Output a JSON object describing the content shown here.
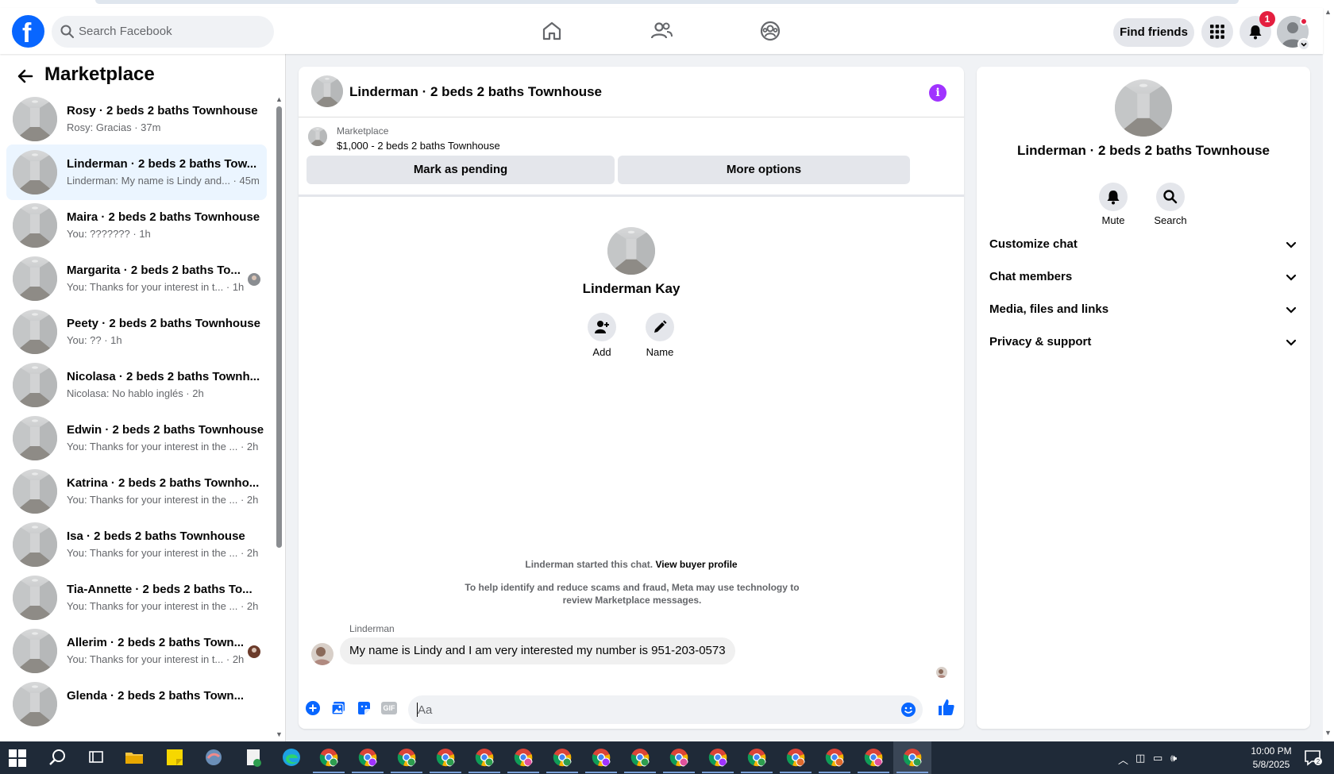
{
  "header": {
    "logo_letter": "f",
    "search_placeholder": "Search Facebook",
    "find_friends_label": "Find friends",
    "notification_count": "1"
  },
  "sidebar": {
    "title": "Marketplace",
    "conversations": [
      {
        "name": "Rosy · 2 beds 2 baths Townhouse",
        "preview": "Rosy: Gracias · 37m",
        "active": false
      },
      {
        "name": "Linderman · 2 beds 2 baths Tow...",
        "preview": "Linderman: My name is Lindy and... · 45m",
        "active": true
      },
      {
        "name": "Maira · 2 beds 2 baths Townhouse",
        "preview": "You: ??????? · 1h",
        "active": false
      },
      {
        "name": "Margarita · 2 beds 2 baths To...",
        "preview": "You: Thanks for your interest in t... · 1h",
        "active": false
      },
      {
        "name": "Peety · 2 beds 2 baths Townhouse",
        "preview": "You: ?? · 1h",
        "active": false
      },
      {
        "name": "Nicolasa · 2 beds 2 baths Townh...",
        "preview": "Nicolasa: No hablo inglés · 2h",
        "active": false
      },
      {
        "name": "Edwin · 2 beds 2 baths Townhouse",
        "preview": "You: Thanks for your interest in the ... · 2h",
        "active": false
      },
      {
        "name": "Katrina · 2 beds 2 baths Townho...",
        "preview": "You: Thanks for your interest in the ... · 2h",
        "active": false
      },
      {
        "name": "Isa · 2 beds 2 baths Townhouse",
        "preview": "You: Thanks for your interest in the ... · 2h",
        "active": false
      },
      {
        "name": "Tia-Annette · 2 beds 2 baths To...",
        "preview": "You: Thanks for your interest in the ... · 2h",
        "active": false
      },
      {
        "name": "Allerim · 2 beds 2 baths Town...",
        "preview": "You: Thanks for your interest in t... · 2h",
        "active": false
      },
      {
        "name": "Glenda · 2 beds 2 baths Town...",
        "preview": "",
        "active": false
      }
    ]
  },
  "chat": {
    "title": "Linderman · 2 beds 2 baths Townhouse",
    "marketplace_label": "Marketplace",
    "listing": "$1,000 - 2 beds 2 baths Townhouse",
    "mark_pending_label": "Mark as pending",
    "more_options_label": "More options",
    "profile_name": "Linderman Kay",
    "add_label": "Add",
    "name_label": "Name",
    "started_text": "Linderman started this chat.",
    "view_buyer_label": "View buyer profile",
    "safety_text": "To help identify and reduce scams and fraud, Meta may use technology to review Marketplace messages.",
    "sender": "Linderman",
    "message": "My name is Lindy and I am very interested my number is 951-203-0573",
    "composer_placeholder": "Aa",
    "gif_label": "GIF"
  },
  "right_panel": {
    "name": "Linderman · 2 beds 2 baths Townhouse",
    "mute_label": "Mute",
    "search_label": "Search",
    "sections": [
      "Customize chat",
      "Chat members",
      "Media, files and links",
      "Privacy & support"
    ]
  },
  "taskbar": {
    "time": "10:00 PM",
    "date": "5/8/2025"
  },
  "colors": {
    "brand": "#0866ff",
    "active_conversation": "#ebf5ff",
    "info_purple": "#a033ff",
    "badge_red": "#e41e3f",
    "taskbar": "#1f2a38"
  }
}
